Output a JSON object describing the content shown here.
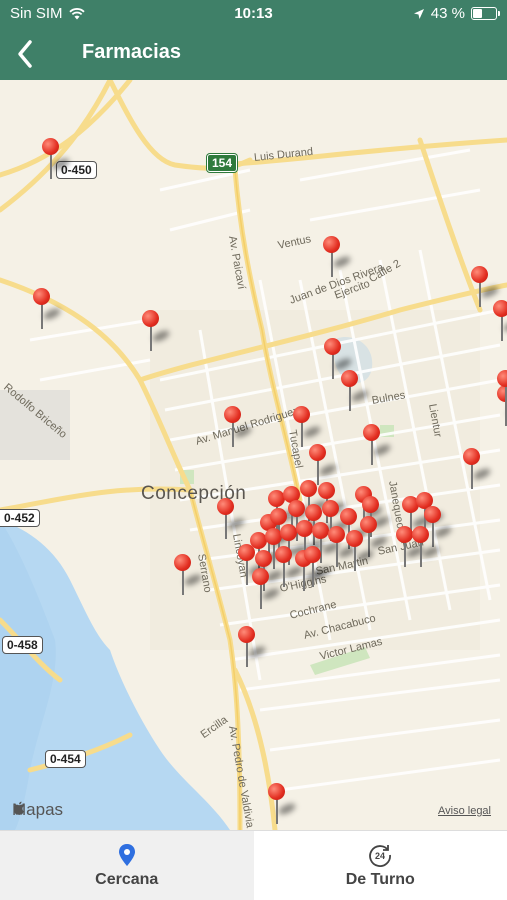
{
  "status_bar": {
    "carrier": "Sin SIM",
    "time": "10:13",
    "battery_percent": "43 %",
    "battery_level": 0.43
  },
  "nav": {
    "title": "Farmacias"
  },
  "map": {
    "city": "Concepción",
    "attribution": "Mapas",
    "legal": "Aviso legal",
    "highway": "154",
    "road_badges": [
      "0-450",
      "0-452",
      "0-458",
      "0-454"
    ],
    "streets": [
      "Luis Durand",
      "Ventus",
      "Juan de Dios Rivera",
      "Ejercito",
      "Calle 2",
      "Rodolfo Briceño",
      "Av. Manuel Rodriguez",
      "Tucapel",
      "Bulnes",
      "Lientur",
      "Av. Paicaví",
      "Janequeo",
      "Serrano",
      "Lincoyan",
      "O'Higgins",
      "San Martin",
      "Cochrane",
      "Av. Chacabuco",
      "Victor Lamas",
      "Ercilla",
      "Av. Pedro de Valdivia",
      "San Juan"
    ]
  },
  "tabs": [
    {
      "label": "Cercana",
      "icon": "location-pin-icon",
      "active": true
    },
    {
      "label": "De Turno",
      "icon": "clock-24-icon",
      "active": false
    }
  ],
  "colors": {
    "header": "#3f8068",
    "pin": "#e22d20",
    "water": "#b6d8f2",
    "road": "#f7dc8c"
  }
}
